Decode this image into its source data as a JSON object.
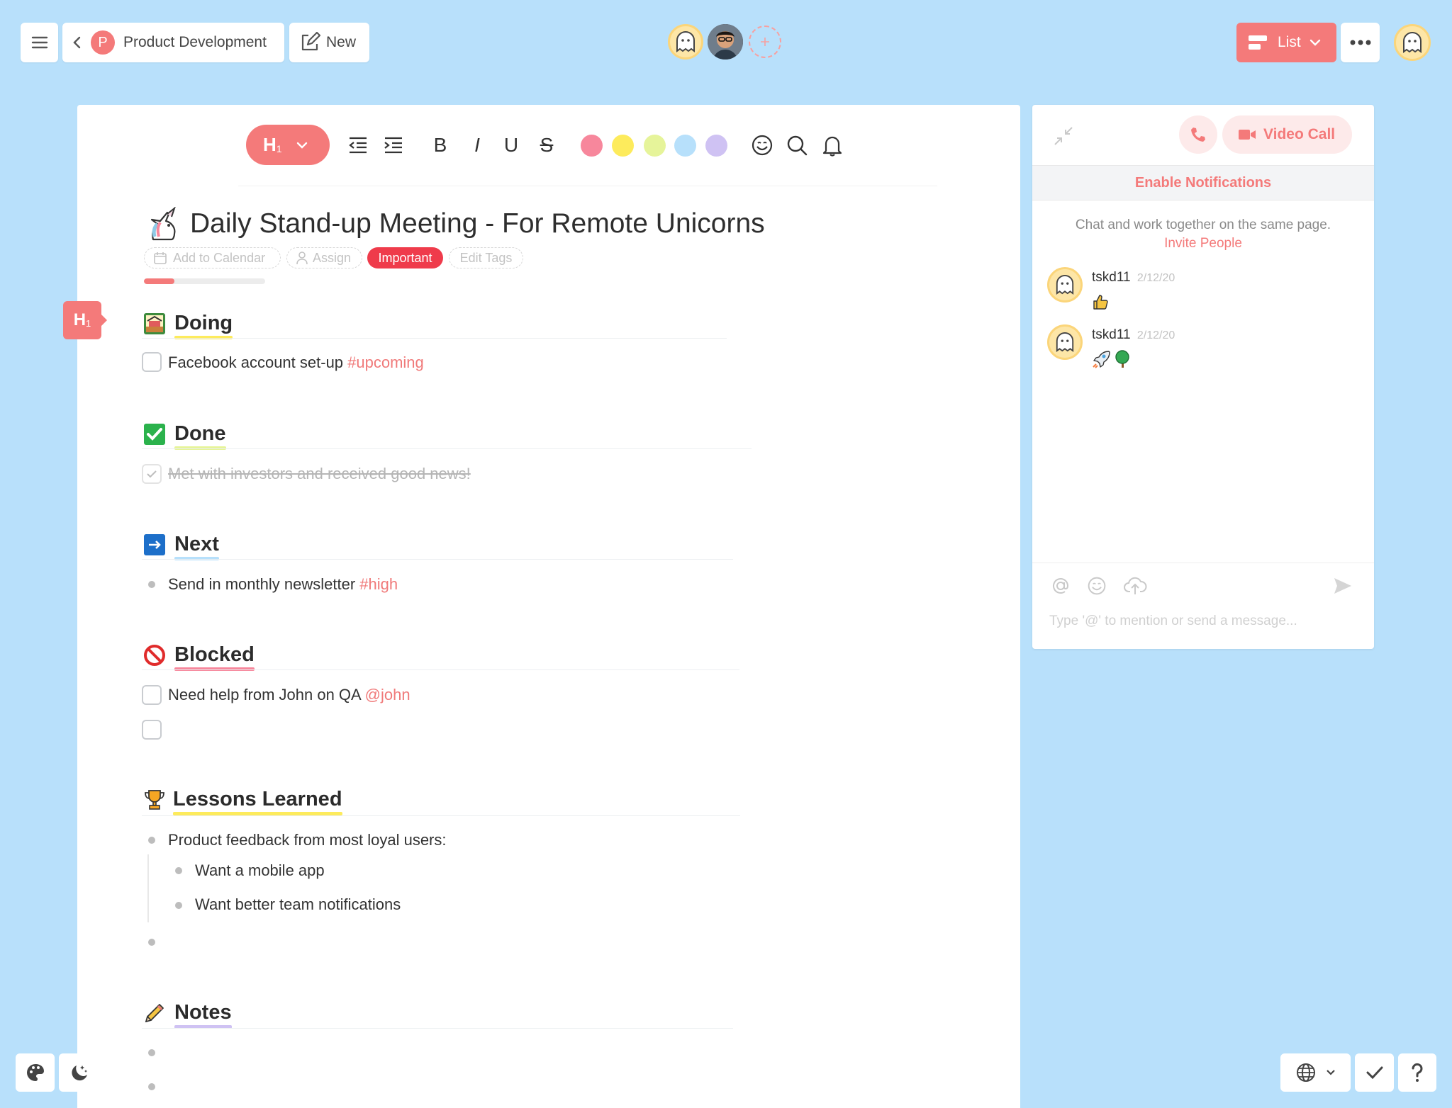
{
  "header": {
    "breadcrumb_initial": "P",
    "project_name": "Product Development",
    "new_label": "New",
    "view_label": "List"
  },
  "toolbar": {
    "heading_label": "H",
    "heading_sub": "1",
    "bold": "B",
    "italic": "I",
    "underline": "U",
    "strike": "S",
    "colors": [
      "#f7879c",
      "#fdeb5c",
      "#e6f49a",
      "#b7e0fb",
      "#cfc2f3"
    ]
  },
  "doc": {
    "title": "Daily Stand-up Meeting - For Remote Unicorns",
    "chips": {
      "calendar": "Add to Calendar",
      "assign": "Assign",
      "important": "Important",
      "edit_tags": "Edit Tags"
    },
    "progress": 0.25,
    "heading_marker": {
      "h": "H",
      "sub": "1"
    },
    "sections": {
      "doing": {
        "title": "Doing",
        "underline": "#fdeb5c",
        "items": [
          {
            "text": "Facebook account set-up ",
            "tag": "#upcoming"
          }
        ]
      },
      "done": {
        "title": "Done",
        "underline": "#e6f49a",
        "items": [
          {
            "text": "Met with investors and received good news!"
          }
        ]
      },
      "next": {
        "title": "Next",
        "underline": "#b7e0fb",
        "items": [
          {
            "text": "Send in monthly newsletter ",
            "tag": "#high"
          }
        ]
      },
      "blocked": {
        "title": "Blocked",
        "underline": "#f7879c",
        "items": [
          {
            "text": "Need help from John on QA ",
            "tag": "@john"
          }
        ]
      },
      "lessons": {
        "title": "Lessons Learned",
        "underline": "#fdeb5c",
        "items": [
          {
            "text": "Product feedback from most loyal users:"
          },
          {
            "text": "Want a mobile app"
          },
          {
            "text": "Want better team notifications"
          }
        ]
      },
      "notes": {
        "title": "Notes",
        "underline": "#cfc2f3"
      }
    }
  },
  "chat": {
    "video_label": "Video Call",
    "enable_notifications": "Enable Notifications",
    "intro": "Chat and work together on the same page.",
    "invite": "Invite People",
    "messages": [
      {
        "user": "tskd11",
        "date": "2/12/20"
      },
      {
        "user": "tskd11",
        "date": "2/12/20"
      }
    ],
    "placeholder": "Type '@' to mention or send a message..."
  },
  "icons": [
    "menu-icon",
    "chevron-left-icon",
    "edit-icon",
    "list-view-icon",
    "more-icon",
    "ghost-avatar-icon",
    "add-user-icon",
    "outdent-icon",
    "indent-icon",
    "emoji-icon",
    "search-icon",
    "bell-icon",
    "unicorn-icon",
    "calendar-icon",
    "person-icon",
    "collapse-icon",
    "phone-icon",
    "video-icon",
    "at-icon",
    "upload-icon",
    "send-icon",
    "palette-icon",
    "moon-icon",
    "globe-icon",
    "check-icon",
    "help-icon"
  ]
}
